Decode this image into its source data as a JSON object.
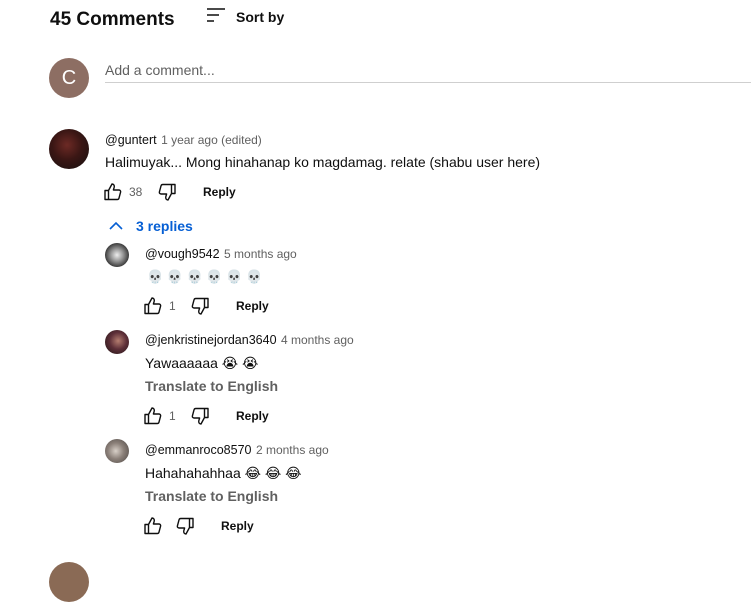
{
  "comments_header": {
    "title": "45 Comments",
    "sort_label": "Sort by"
  },
  "add_comment": {
    "avatar_letter": "C",
    "placeholder": "Add a comment..."
  },
  "comment": {
    "author": "@guntert",
    "time": "1 year ago (edited)",
    "text": "Halimuyak... Mong hinahanap ko magdamag. relate (shabu user here)",
    "likes": "38",
    "reply_label": "Reply",
    "replies_toggle": "3 replies",
    "replies": [
      {
        "author": "@vough9542",
        "time": "5 months ago",
        "text": "💀 💀 💀 💀 💀 💀",
        "likes": "1",
        "reply_label": "Reply",
        "translate": ""
      },
      {
        "author": "@jenkristinejordan3640",
        "time": "4 months ago",
        "text": "Yawaaaaaa 😭 😭",
        "likes": "1",
        "reply_label": "Reply",
        "translate": "Translate to English"
      },
      {
        "author": "@emmanroco8570",
        "time": "2 months ago",
        "text": "Hahahahahhaa 😂 😂 😂",
        "likes": "",
        "reply_label": "Reply",
        "translate": "Translate to English"
      }
    ]
  },
  "icons": {
    "sort": "sort-icon",
    "like": "thumbs-up-icon",
    "dislike": "thumbs-down-icon",
    "collapse": "chevron-up-icon"
  },
  "colors": {
    "link_blue": "#065fd4",
    "avatar_brown": "#8d6e63",
    "secondary_text": "#606060"
  }
}
